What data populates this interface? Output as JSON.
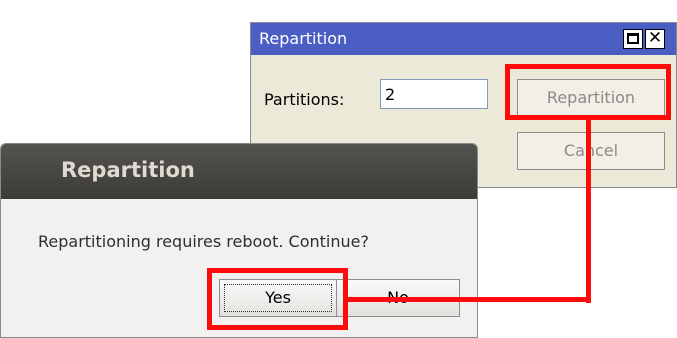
{
  "back_window": {
    "title": "Repartition",
    "partitions_label": "Partitions:",
    "partitions_value": "2",
    "repartition_label": "Repartition",
    "cancel_label": "Cancel",
    "titlebar_color": "#4b5ec3"
  },
  "dialog": {
    "title": "Repartition",
    "message": "Repartitioning requires reboot. Continue?",
    "yes_label": "Yes",
    "no_label": "No"
  },
  "annotation": {
    "highlight_color": "#ff0b0b"
  }
}
